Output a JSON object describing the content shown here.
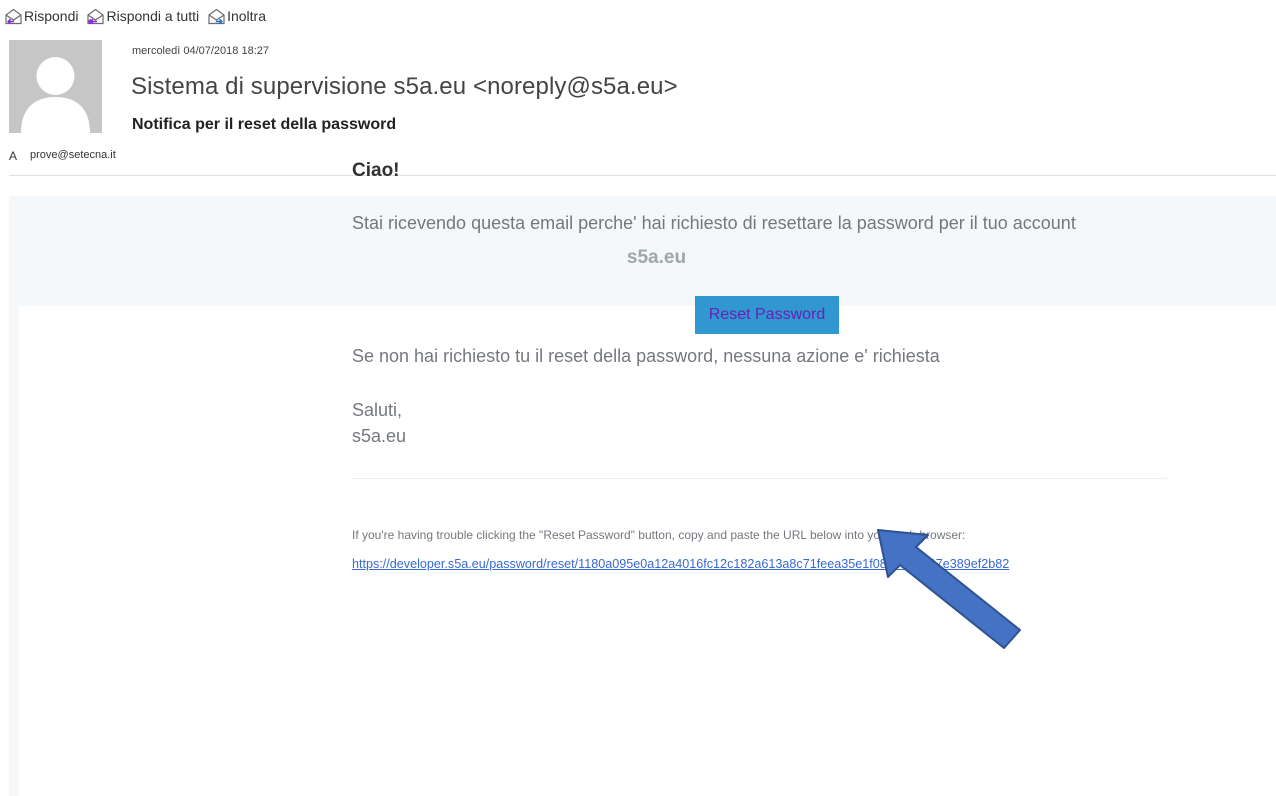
{
  "toolbar": {
    "reply_label": "Rispondi",
    "reply_all_label": "Rispondi a tutti",
    "forward_label": "Inoltra"
  },
  "message": {
    "date": "mercoledì 04/07/2018 18:27",
    "sender": "Sistema di supervisione s5a.eu <noreply@s5a.eu>",
    "subject": "Notifica per il reset della password",
    "to_label": "A",
    "to_address": "prove@setecna.it"
  },
  "email": {
    "brand": "s5a.eu",
    "greeting": "Ciao!",
    "intro": "Stai ricevendo questa email perche' hai richiesto di resettare la password per il tuo account",
    "button_label": "Reset Password",
    "outro": "Se non hai richiesto tu il reset della password, nessuna azione e' richiesta",
    "salutation": "Saluti,",
    "signature": "s5a.eu",
    "subcopy": "If you're having trouble clicking the \"Reset Password\" button, copy and paste the URL below into your web browser:",
    "url": "https://developer.s5a.eu/password/reset/1180a095e0a12a4016fc12c182a613a8c71feea35e1f080b78d907e389ef2b82"
  },
  "colors": {
    "button_bg": "#3097d1",
    "button_text": "#6a1fb5",
    "arrow": "#4472c4",
    "body_text": "#74787e",
    "link": "#3869d4"
  }
}
